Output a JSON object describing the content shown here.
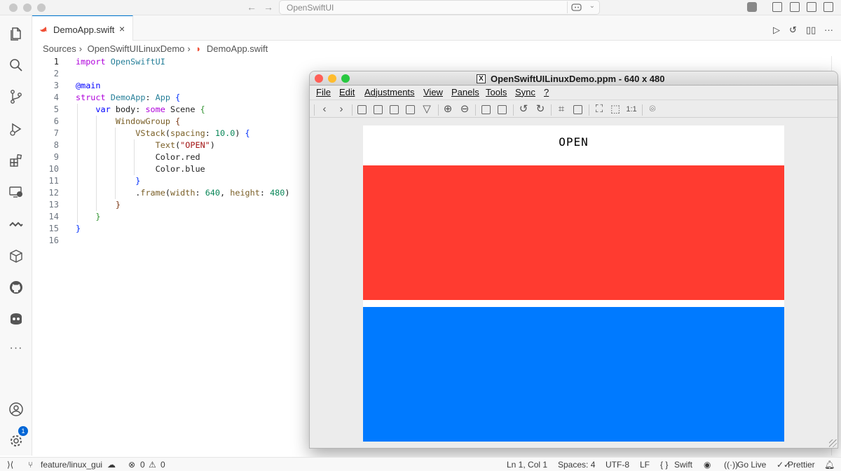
{
  "window": {
    "search_text": "OpenSwiftUI"
  },
  "tab": {
    "label": "DemoApp.swift",
    "close": "×"
  },
  "breadcrumb": [
    "Sources",
    "OpenSwiftUILinuxDemo",
    "DemoApp.swift"
  ],
  "editor": {
    "line_numbers": [
      "1",
      "2",
      "3",
      "4",
      "5",
      "6",
      "7",
      "8",
      "9",
      "10",
      "11",
      "12",
      "13",
      "14",
      "15",
      "16"
    ],
    "active_line": "1"
  },
  "statusbar": {
    "branch": "feature/linux_gui",
    "errors": "0",
    "warnings": "0",
    "position": "Ln 1, Col 1",
    "spaces": "Spaces: 4",
    "encoding": "UTF-8",
    "eol": "LF",
    "language": "Swift",
    "go_live": "Go Live",
    "prettier": "Prettier"
  },
  "activity": {
    "accounts_badge": "1"
  },
  "viewer": {
    "title": "OpenSwiftUILinuxDemo.ppm  - 640 x 480",
    "menu": [
      "File",
      "Edit",
      "Adjustments",
      "View",
      "Panels",
      "Tools",
      "Sync",
      "?"
    ],
    "image_text": "OPEN",
    "top_color": "#ff3b30",
    "bottom_color": "#007aff"
  },
  "icons": {
    "activity": [
      "files-icon",
      "search-icon",
      "source-control-icon",
      "run-debug-icon",
      "extensions-icon",
      "remote-explorer-icon",
      "wave-icon",
      "package-icon",
      "github-icon",
      "godot-icon",
      "more-icon",
      "accounts-icon",
      "gear-icon"
    ]
  }
}
